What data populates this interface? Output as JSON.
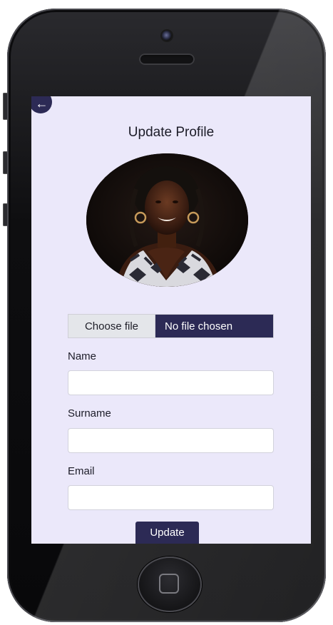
{
  "screen": {
    "title": "Update Profile",
    "back_icon": "←",
    "file_input": {
      "button_label": "Choose file",
      "status": "No file chosen"
    },
    "fields": [
      {
        "label": "Name",
        "value": "",
        "placeholder": ""
      },
      {
        "label": "Surname",
        "value": "",
        "placeholder": ""
      },
      {
        "label": "Email",
        "value": "",
        "placeholder": ""
      }
    ],
    "submit_label": "Update"
  },
  "colors": {
    "accent": "#2c2a55",
    "screen_background": "#ebe8fa",
    "phone_body": "#0e0e10"
  },
  "icons": [
    "arrow-left-icon",
    "home-button-icon",
    "camera-icon",
    "speaker-grille-icon"
  ]
}
